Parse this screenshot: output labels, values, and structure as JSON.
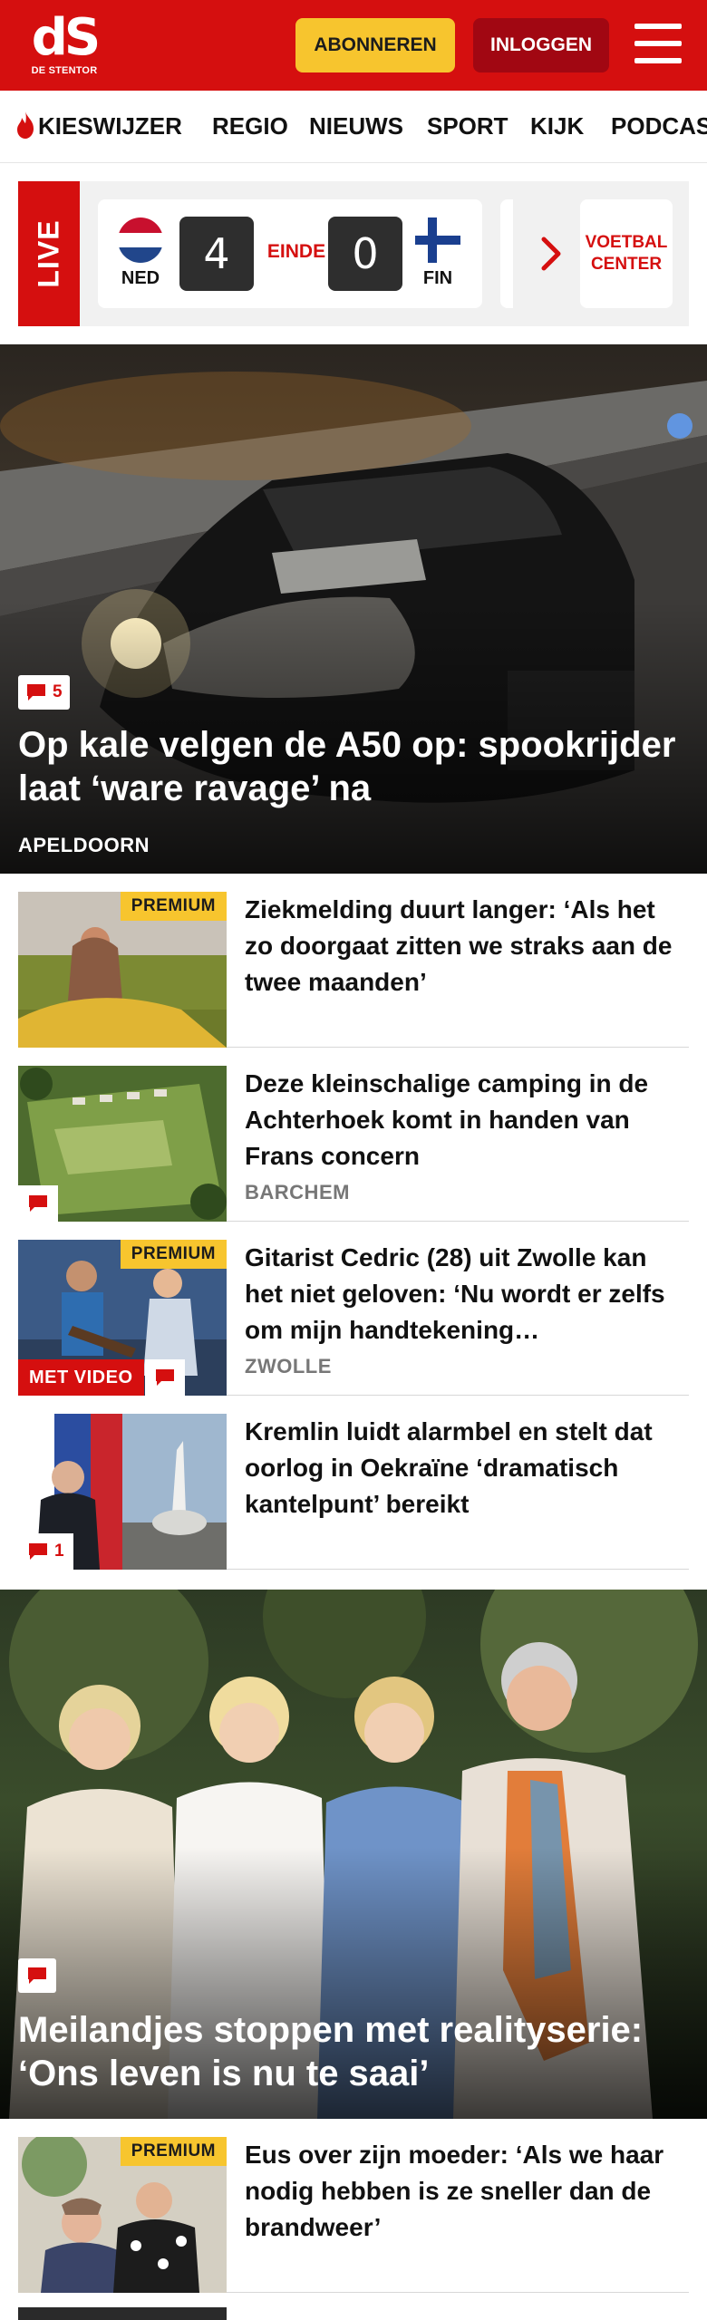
{
  "header": {
    "logo_mark": "dS",
    "logo_sub": "DE STENTOR",
    "subscribe_label": "ABONNEREN",
    "login_label": "INLOGGEN"
  },
  "nav": {
    "items": [
      "KIESWIJZER",
      "REGIO",
      "NIEUWS",
      "SPORT",
      "KIJK",
      "PODCAST"
    ]
  },
  "live": {
    "label": "LIVE",
    "home_team": "NED",
    "home_score": "4",
    "status": "EINDE",
    "away_score": "0",
    "away_team": "FIN",
    "center_line1": "VOETBAL",
    "center_line2": "CENTER"
  },
  "hero1": {
    "comments": "5",
    "title": "Op kale velgen de A50 op: spookrijder laat ‘ware ravage’ na",
    "location": "APELDOORN"
  },
  "articles": [
    {
      "title": "Ziekmelding duurt langer: ‘Als het zo doorgaat zitten we straks aan de twee maanden’",
      "premium": "PREMIUM"
    },
    {
      "title": "Deze kleinschalige camping in de Achterhoek komt in handen van Frans concern",
      "location": "BARCHEM"
    },
    {
      "title": "Gitarist Cedric (28) uit Zwolle kan het niet geloven: ‘Nu wordt er zelfs om mĳn handtekening…",
      "location": "ZWOLLE",
      "premium": "PREMIUM",
      "video": "MET VIDEO"
    },
    {
      "title": "Kremlin luidt alarmbel en stelt dat oorlog in Oekraïne ‘dramatisch kantelpunt’ bereikt",
      "comments": "1"
    },
    {
      "title": "Eus over zijn moeder: ‘Als we haar nodig hebben is ze sneller dan de brandweer’",
      "premium": "PREMIUM"
    }
  ],
  "hero2": {
    "title": "Meilandjes stoppen met realityserie: ‘Ons leven is nu te saai’"
  },
  "colors": {
    "brand_red": "#d50f0f",
    "premium_yellow": "#f7c52e",
    "login_dark_red": "#a10712"
  }
}
